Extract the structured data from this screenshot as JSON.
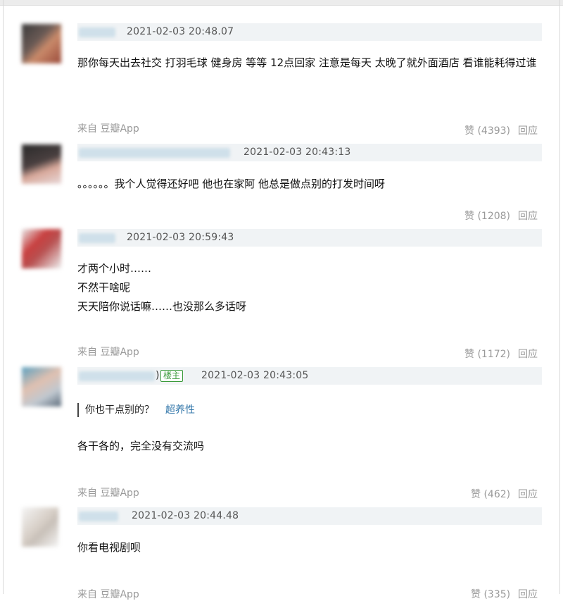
{
  "comments": [
    {
      "time": "2021-02-03 20:48.07",
      "text": "那你每天出去社交 打羽毛球 健身房 等等 12点回家 注意是每天 太晚了就外面酒店 看谁能耗得过谁",
      "from": "来自 豆瓣App",
      "likes": "赞 (4393)",
      "reply": "回应"
    },
    {
      "time": "2021-02-03 20:43:13",
      "text": "。。。。。。我个人觉得还好吧 他也在家阿 他总是做点别的打发时间呀",
      "likes": "赞 (1208)",
      "reply": "回应"
    },
    {
      "time": "2021-02-03 20:59:43",
      "lines": [
        "才两个小时……",
        "不然干啥呢",
        "天天陪你说话嘛……也没那么多话呀"
      ],
      "from": "来自 豆瓣App",
      "likes": "赞 (1172)",
      "reply": "回应"
    },
    {
      "time": "2021-02-03 20:43:05",
      "paren": ")",
      "badge": "楼主",
      "quote_text": "你也干点别的？",
      "quote_author": "超养性",
      "text": "各干各的，完全没有交流吗",
      "from": "来自 豆瓣App",
      "likes": "赞 (462)",
      "reply": "回应"
    },
    {
      "time": "2021-02-03 20:44.48",
      "text": "你看电视剧呗",
      "from": "来自 豆瓣App",
      "likes": "赞 (335)",
      "reply": "回应"
    }
  ],
  "colors": {
    "header_bg": "#f0f3f5",
    "link": "#3377aa",
    "op_badge": "#3a9a3a",
    "meta": "#999999"
  }
}
